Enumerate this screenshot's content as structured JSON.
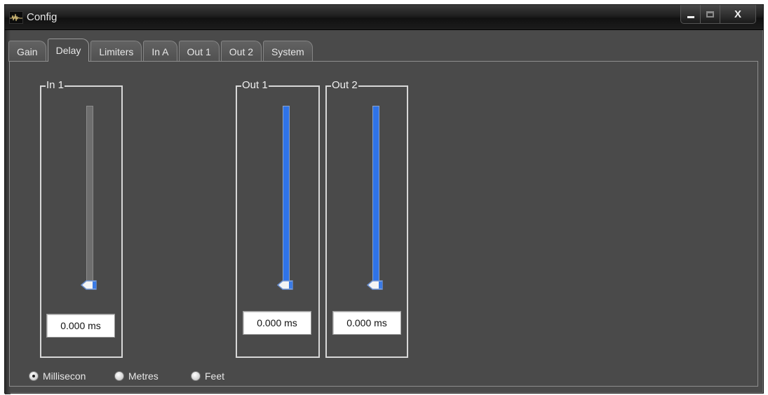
{
  "window": {
    "title": "Config",
    "icon": "waveform-icon",
    "controls": {
      "minimize": "minimize-icon",
      "maximize": "maximize-icon",
      "close_label": "X"
    }
  },
  "tabs": [
    {
      "label": "Gain",
      "active": false
    },
    {
      "label": "Delay",
      "active": true
    },
    {
      "label": "Limiters",
      "active": false
    },
    {
      "label": "In A",
      "active": false
    },
    {
      "label": "Out 1",
      "active": false
    },
    {
      "label": "Out 2",
      "active": false
    },
    {
      "label": "System",
      "active": false
    }
  ],
  "channels": [
    {
      "label": "In 1",
      "value": "0.000 ms",
      "slider_level": 0,
      "enabled": false
    },
    {
      "label": "Out 1",
      "value": "0.000 ms",
      "slider_level": 0,
      "enabled": true
    },
    {
      "label": "Out 2",
      "value": "0.000 ms",
      "slider_level": 0,
      "enabled": true
    }
  ],
  "units": {
    "options": [
      {
        "label": "Millisecon",
        "checked": true
      },
      {
        "label": "Metres",
        "checked": false
      },
      {
        "label": "Feet",
        "checked": false
      }
    ]
  },
  "colors": {
    "window_bg": "#4a4a4a",
    "slider_active": "#2f73e8",
    "slider_inactive": "#6e6e6e"
  }
}
